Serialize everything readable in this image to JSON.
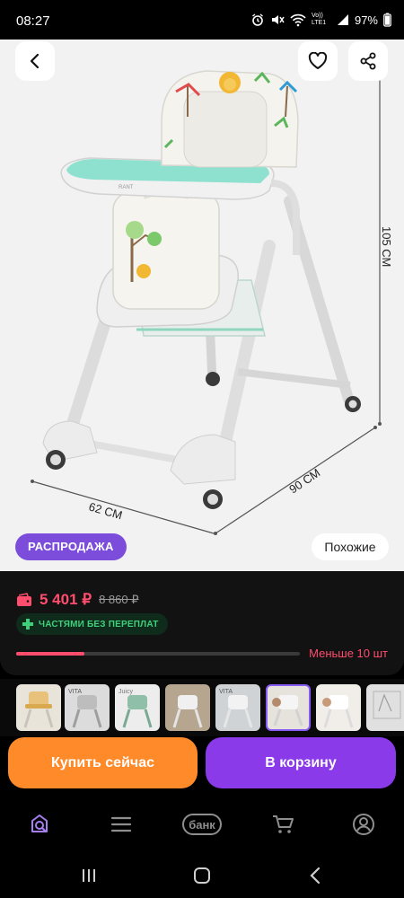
{
  "status_bar": {
    "time": "08:27",
    "network": "Vo)) LTE1",
    "battery": "97%",
    "icons": [
      "alarm-icon",
      "mute-icon",
      "wifi-icon",
      "signal-icon",
      "battery-icon"
    ]
  },
  "product_image": {
    "dimension_height": "105 СМ",
    "dimension_depth": "90 СМ",
    "dimension_width": "62 СМ",
    "brand_mark": "RANT",
    "sale_badge": "РАСПРОДАЖА",
    "similar_button": "Похожие"
  },
  "pricing": {
    "current_price": "5 401 ₽",
    "old_price": "8 860 ₽",
    "installments_label": "ЧАСТЯМИ БЕЗ ПЕРЕПЛАТ",
    "stock_label": "Меньше 10 шт",
    "stock_fraction": 0.24
  },
  "thumbnails": {
    "count": 8,
    "active_index": 5,
    "labels": [
      "VITA",
      "Juicy",
      "VITA"
    ]
  },
  "actions": {
    "buy_now": "Купить сейчас",
    "add_to_cart": "В корзину"
  },
  "bottom_nav": {
    "bank_label": "банк",
    "items": [
      "search-catalog-icon",
      "menu-icon",
      "bank",
      "cart-icon",
      "profile-icon"
    ]
  },
  "colors": {
    "accent_purple": "#8a3ae8",
    "accent_orange": "#ff8a2a",
    "price_red": "#ff4d6d",
    "installments_green": "#3fd07a",
    "sale_badge": "#7c4ddb"
  }
}
